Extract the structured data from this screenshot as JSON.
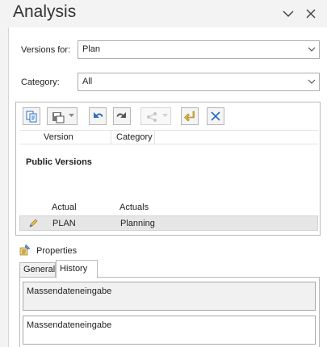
{
  "pane": {
    "title": "Analysis"
  },
  "filters": {
    "versions_label": "Versions for:",
    "versions_value": "Plan",
    "category_label": "Category:",
    "category_value": "All"
  },
  "grid": {
    "columns": [
      "Version",
      "Category"
    ],
    "group_title": "Public Versions",
    "rows": [
      {
        "version": "Actual",
        "category": "Actuals",
        "selected": false
      },
      {
        "version": "PLAN",
        "category": "Planning",
        "selected": true
      }
    ]
  },
  "properties": {
    "header": "Properties",
    "tabs": [
      "General",
      "History"
    ],
    "active_tab": "History",
    "history_readonly": "Massendateneingabe",
    "history_input": "Massendateneingabe"
  },
  "colors": {
    "accent_blue": "#2a6cc4",
    "undo_blue": "#2f6db5",
    "arrow_dark": "#555555",
    "undo_yellow": "#e2b93a"
  },
  "icons": [
    "chevron-down-icon",
    "close-icon",
    "copy-icon",
    "save-icon",
    "undo-icon",
    "redo-icon",
    "share-icon",
    "undo-changes-icon",
    "delete-icon",
    "pencil-icon",
    "properties-icon"
  ]
}
